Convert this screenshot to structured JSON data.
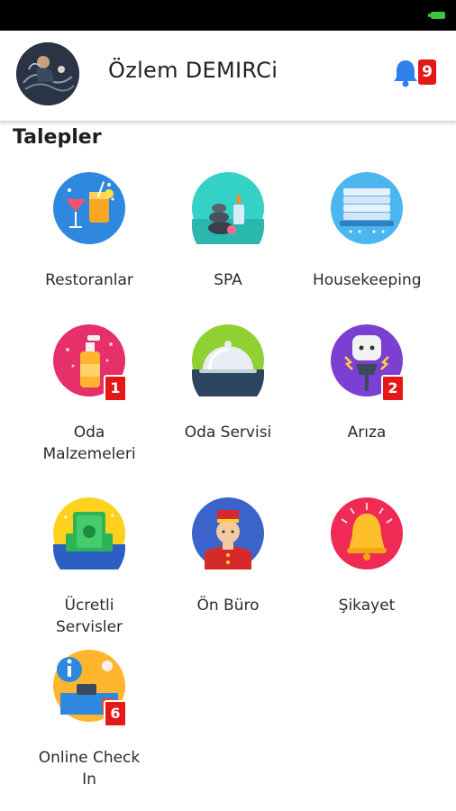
{
  "header": {
    "user_name": "Özlem DEMIRCi",
    "notification_count": "9"
  },
  "section": {
    "title": "Talepler"
  },
  "tiles": [
    {
      "label": "Restoranlar",
      "icon": "cocktail-icon",
      "badge": ""
    },
    {
      "label": "SPA",
      "icon": "spa-stones-icon",
      "badge": ""
    },
    {
      "label": "Housekeeping",
      "icon": "towels-icon",
      "badge": ""
    },
    {
      "label": "Oda Malzemeleri",
      "icon": "shampoo-bottle-icon",
      "badge": "1"
    },
    {
      "label": "Oda Servisi",
      "icon": "cloche-icon",
      "badge": ""
    },
    {
      "label": "Arıza",
      "icon": "electric-plug-icon",
      "badge": "2"
    },
    {
      "label": "Ücretli Servisler",
      "icon": "money-icon",
      "badge": ""
    },
    {
      "label": "Ön Büro",
      "icon": "bellboy-icon",
      "badge": ""
    },
    {
      "label": "Şikayet",
      "icon": "alarm-bell-icon",
      "badge": ""
    },
    {
      "label": "Online Check In",
      "icon": "reception-desk-icon",
      "badge": "6"
    }
  ],
  "colors": {
    "badge": "#e51717",
    "bell": "#2f80ed",
    "status_bar": "#000000",
    "battery": "#3ec43e"
  }
}
